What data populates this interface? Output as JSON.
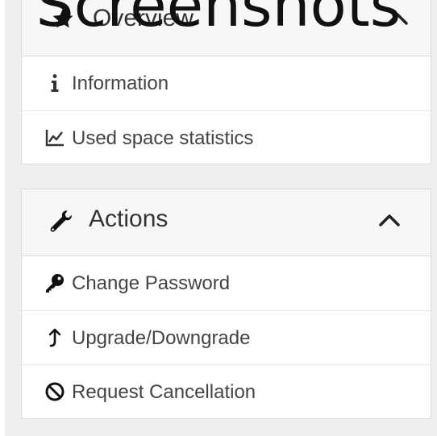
{
  "overlay": {
    "text": "Screenshots"
  },
  "overview_panel": {
    "title": "Overview",
    "icon": "star-icon",
    "items": [
      {
        "label": "Information",
        "icon": "info-icon"
      },
      {
        "label": "Used space statistics",
        "icon": "line-chart-icon"
      }
    ]
  },
  "actions_panel": {
    "title": "Actions",
    "icon": "wrench-icon",
    "items": [
      {
        "label": "Change Password",
        "icon": "key-icon"
      },
      {
        "label": "Upgrade/Downgrade",
        "icon": "arrow-up-icon"
      },
      {
        "label": "Request Cancellation",
        "icon": "ban-icon"
      }
    ]
  },
  "colors": {
    "page_background": "#efefef",
    "panel_background": "#ffffff",
    "panel_header": "#f7f7f7",
    "border": "#dcdcdc",
    "text": "#333333"
  }
}
